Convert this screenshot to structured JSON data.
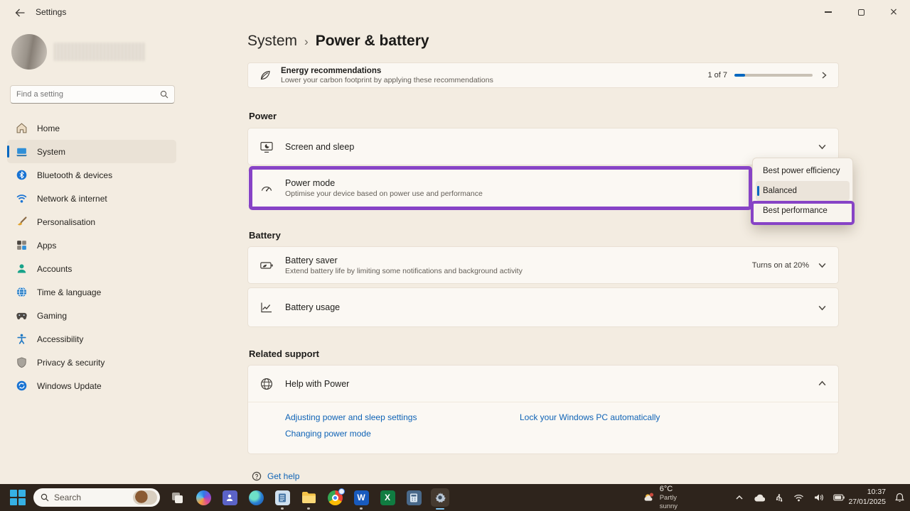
{
  "window": {
    "title": "Settings"
  },
  "sidebar": {
    "search_placeholder": "Find a setting",
    "items": [
      {
        "label": "Home",
        "icon": "home-icon",
        "selected": false
      },
      {
        "label": "System",
        "icon": "system-icon",
        "selected": true
      },
      {
        "label": "Bluetooth & devices",
        "icon": "bluetooth-icon",
        "selected": false
      },
      {
        "label": "Network & internet",
        "icon": "network-icon",
        "selected": false
      },
      {
        "label": "Personalisation",
        "icon": "personalisation-icon",
        "selected": false
      },
      {
        "label": "Apps",
        "icon": "apps-icon",
        "selected": false
      },
      {
        "label": "Accounts",
        "icon": "accounts-icon",
        "selected": false
      },
      {
        "label": "Time & language",
        "icon": "time-language-icon",
        "selected": false
      },
      {
        "label": "Gaming",
        "icon": "gaming-icon",
        "selected": false
      },
      {
        "label": "Accessibility",
        "icon": "accessibility-icon",
        "selected": false
      },
      {
        "label": "Privacy & security",
        "icon": "privacy-icon",
        "selected": false
      },
      {
        "label": "Windows Update",
        "icon": "windows-update-icon",
        "selected": false
      }
    ]
  },
  "breadcrumb": {
    "parent": "System",
    "separator": "›",
    "current": "Power & battery"
  },
  "energy_banner": {
    "title": "Energy recommendations",
    "subtitle": "Lower your carbon footprint by applying these recommendations",
    "counter": "1 of 7",
    "progress_percent": 14
  },
  "power_section": {
    "header": "Power",
    "screen_sleep": {
      "title": "Screen and sleep"
    },
    "power_mode": {
      "title": "Power mode",
      "subtitle": "Optimise your device based on power use and performance"
    }
  },
  "power_mode_dropdown": {
    "options": [
      {
        "label": "Best power efficiency",
        "selected": false,
        "highlighted": false
      },
      {
        "label": "Balanced",
        "selected": true,
        "highlighted": false
      },
      {
        "label": "Best performance",
        "selected": false,
        "highlighted": true
      }
    ]
  },
  "battery_section": {
    "header": "Battery",
    "battery_saver": {
      "title": "Battery saver",
      "subtitle": "Extend battery life by limiting some notifications and background activity",
      "value": "Turns on at 20%"
    },
    "battery_usage": {
      "title": "Battery usage"
    }
  },
  "related_section": {
    "header": "Related support",
    "help_row": {
      "title": "Help with Power"
    },
    "links": [
      "Adjusting power and sleep settings",
      "Lock your Windows PC automatically",
      "Changing power mode"
    ]
  },
  "footer": {
    "get_help": "Get help"
  },
  "taskbar": {
    "search_label": "Search",
    "pinned_apps": [
      "task-view",
      "copilot",
      "teams",
      "edge",
      "notepad",
      "file-explorer",
      "chrome",
      "word",
      "excel",
      "calculator",
      "settings"
    ],
    "tray_icons": [
      "chevron-up-icon",
      "onedrive-icon",
      "usb-icon",
      "wifi-icon",
      "volume-icon",
      "battery-icon",
      "notifications-bell-icon"
    ],
    "weather": {
      "temperature": "6°C",
      "condition": "Partly sunny"
    },
    "clock": {
      "time": "10:37",
      "date": "27/01/2025"
    }
  },
  "colors": {
    "accent_blue": "#0067c0",
    "annotation_purple": "#8743c6",
    "link_blue": "#0f63b6"
  }
}
